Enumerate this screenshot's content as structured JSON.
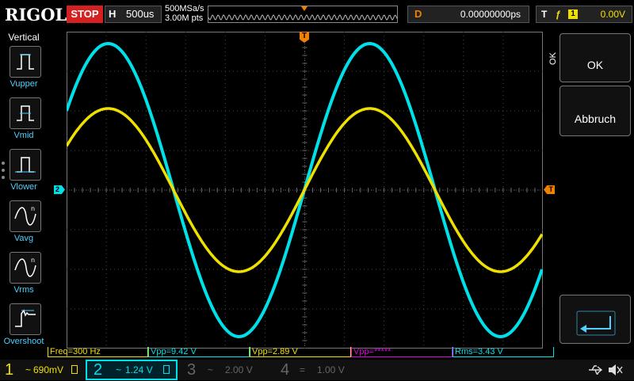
{
  "topbar": {
    "brand": "RIGOL",
    "run_state": "STOP",
    "timebase_key": "H",
    "timebase_value": "500us",
    "sample_rate": "500MSa/s",
    "memory_depth": "3.00M pts",
    "delay_key": "D",
    "delay_value": "0.00000000ps",
    "trigger_key": "T",
    "trigger_channel": "1",
    "trigger_level": "0.00V"
  },
  "left_menu": {
    "title": "Vertical",
    "items": [
      {
        "label": "Vupper",
        "icon": "vupper-icon"
      },
      {
        "label": "Vmid",
        "icon": "vmid-icon"
      },
      {
        "label": "Vlower",
        "icon": "vlower-icon"
      },
      {
        "label": "Vavg",
        "icon": "vavg-icon"
      },
      {
        "label": "Vrms",
        "icon": "vrms-icon"
      },
      {
        "label": "Overshoot",
        "icon": "overshoot-icon"
      }
    ]
  },
  "right_menu": {
    "ok_side_label": "OK",
    "ok_label": "OK",
    "cancel_label": "Abbruch",
    "enter_icon": "enter-icon"
  },
  "markers": {
    "trigger_pos": "T",
    "ch2_offset": "2",
    "trigger_level": "T"
  },
  "measurements": [
    {
      "text": "Freq=300 Hz",
      "color": "#f0e000"
    },
    {
      "text": "Vpp=9.42 V",
      "color": "#00e0e8"
    },
    {
      "text": "Vpp=2.89 V",
      "color": "#f0e000"
    },
    {
      "text": "Vpp=*****",
      "color": "#e000e0"
    },
    {
      "text": "Rms=3.43 V",
      "color": "#00e0e8"
    }
  ],
  "channels": [
    {
      "num": "1",
      "coupling": "~",
      "scale": "690mV",
      "color": "#f0e000",
      "active": true
    },
    {
      "num": "2",
      "coupling": "~",
      "scale": "1.24 V",
      "color": "#00e0e8",
      "active": true
    },
    {
      "num": "3",
      "coupling": "~",
      "scale": "2.00 V",
      "color": "#666666",
      "active": false
    },
    {
      "num": "4",
      "coupling": "=",
      "scale": "1.00 V",
      "color": "#666666",
      "active": false
    }
  ],
  "status_icons": [
    "usb-icon",
    "sound-muted-icon"
  ],
  "colors": {
    "ch1": "#f0e000",
    "ch2": "#00e0e8",
    "trigger": "#f08000",
    "stop": "#d42020"
  }
}
